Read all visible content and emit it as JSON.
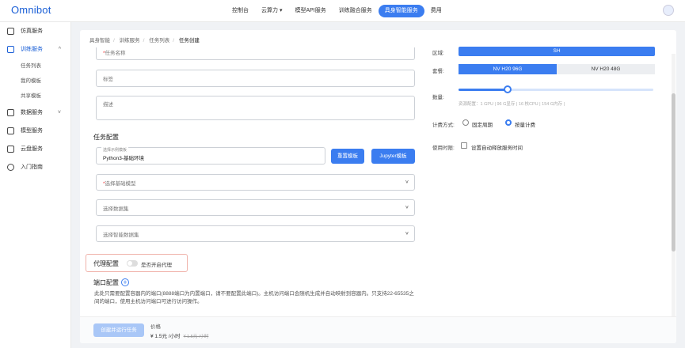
{
  "app": {
    "logo": "Omnibot"
  },
  "nav": [
    {
      "label": "控制台",
      "active": false
    },
    {
      "label": "云算力 ▾",
      "active": false
    },
    {
      "label": "模型API服务",
      "active": false
    },
    {
      "label": "训练融合服务",
      "active": false
    },
    {
      "label": "具身智能服务",
      "active": true
    },
    {
      "label": "费用",
      "active": false
    }
  ],
  "sidebar": {
    "items": [
      {
        "label": "仿真服务"
      },
      {
        "label": "训练服务",
        "caret": "^"
      },
      {
        "label": "数据服务",
        "caret": "˅"
      },
      {
        "label": "模型服务"
      },
      {
        "label": "云盘服务"
      },
      {
        "label": "入门指南"
      }
    ],
    "sub_items": [
      {
        "label": "任务列表"
      },
      {
        "label": "我的模板"
      },
      {
        "label": "共享模板"
      }
    ]
  },
  "breadcrumb": [
    "具身智能",
    "训练服务",
    "任务列表",
    "任务创建"
  ],
  "form": {
    "task_name_placeholder": "任务名称",
    "tag_placeholder": "标签",
    "desc_placeholder": "描述",
    "task_config_title": "任务配置",
    "template_label": "选择示例模板",
    "template_value": "Python3-基础环境",
    "reset_template_button": "重置模板",
    "jupyter_template_button": "Jupyter模板",
    "base_model_placeholder": "选择基础模型",
    "dataset_placeholder": "选择数据集",
    "smart_dataset_placeholder": "选择智能数据集",
    "proxy_title": "代理配置",
    "proxy_toggle_label": "是否开启代理",
    "proxy_enabled": false,
    "port_title": "端口配置",
    "port_note": "此处只需要配置容器内的端口(8888端口为内置端口，请不要配置此端口)。主机访问端口会随机生成并自动映射到容器内。只支持22-65535之间的端口，使用主机访问端口可进行访问操作。"
  },
  "right_panel": {
    "region_label": "区域:",
    "region_value": "SH",
    "package_label": "套餐:",
    "packages": [
      {
        "label": "NV H20 96G",
        "selected": true
      },
      {
        "label": "NV H20 48G",
        "selected": false
      }
    ],
    "quantity_label": "数量:",
    "quantity_fraction": 0.25,
    "resource_note": "资源配置：1 GPU | 96 G显存 | 16 核CPU | 154 G内存 |",
    "billing_label": "计费方式:",
    "billing_options": [
      {
        "label": "固定周期",
        "selected": false
      },
      {
        "label": "按量计费",
        "selected": true
      }
    ],
    "usage_time_label": "使用时限:",
    "auto_release_label": "设置自动释放服务时间",
    "auto_release_checked": false
  },
  "footer": {
    "create_button": "创建并运行任务",
    "price_label": "价格",
    "price_value": "¥ 1.5元 /小时",
    "price_original": "¥ 1.5元 /小时"
  },
  "colors": {
    "accent": "#3b7df0",
    "brand": "#1a5fd6"
  }
}
